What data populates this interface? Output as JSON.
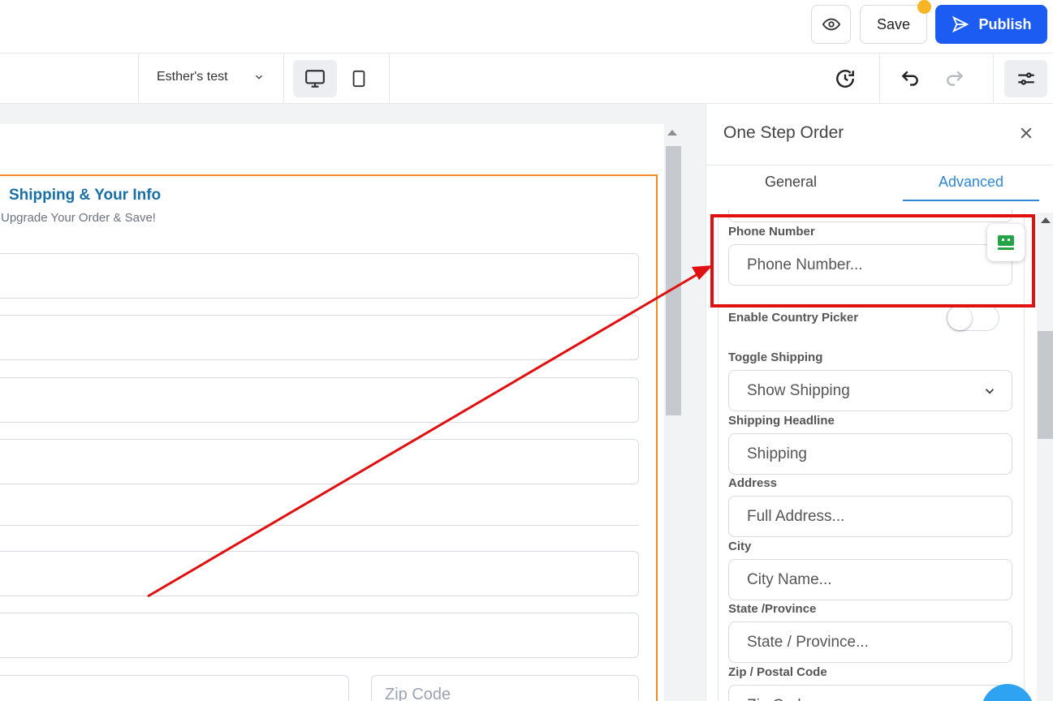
{
  "header": {
    "save_label": "Save",
    "publish_label": "Publish"
  },
  "toolbar": {
    "page_name": "Esther's test"
  },
  "canvas": {
    "headline": "Shipping & Your Info",
    "subheadline": "Upgrade Your Order & Save!",
    "zip_placeholder": "Zip Code"
  },
  "panel": {
    "title": "One Step Order",
    "tabs": [
      "General",
      "Advanced"
    ],
    "active_tab": "Advanced",
    "fields": {
      "phone_label": "Phone Number",
      "phone_placeholder": "Phone Number...",
      "country_picker_label": "Enable Country Picker",
      "country_picker_enabled": false,
      "toggle_shipping_label": "Toggle Shipping",
      "toggle_shipping_value": "Show Shipping",
      "shipping_headline_label": "Shipping Headline",
      "shipping_headline_value": "Shipping",
      "address_label": "Address",
      "address_placeholder": "Full Address...",
      "city_label": "City",
      "city_placeholder": "City Name...",
      "state_label": "State /Province",
      "state_placeholder": "State / Province...",
      "zip_label": "Zip / Postal Code",
      "zip_placeholder": "Zip Code..."
    }
  },
  "colors": {
    "publish_bg": "#1c5cf2",
    "accent_blue": "#2f86d6",
    "form_border": "#f08a24",
    "highlight_red": "#e01010",
    "headline_blue": "#1a6fa6"
  }
}
